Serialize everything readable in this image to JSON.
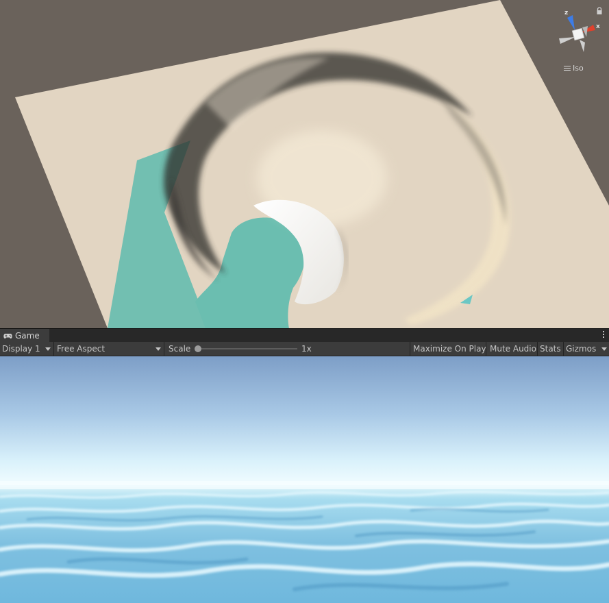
{
  "scene_view": {
    "gizmo": {
      "axis_z": "z",
      "axis_x": "x"
    },
    "projection_label": "Iso",
    "colors": {
      "background": "#6a625b",
      "terrain": "#e2d5c2",
      "water": "#6bbeb0",
      "snow": "#f7f6f1"
    }
  },
  "game_tab": {
    "label": "Game",
    "icon": "gamepad-icon"
  },
  "game_toolbar": {
    "display_select": "Display 1",
    "aspect_select": "Free Aspect",
    "scale_label": "Scale",
    "scale_value": "1x",
    "scale_fraction": 0,
    "maximize_on_play": "Maximize On Play",
    "mute_audio": "Mute Audio",
    "stats": "Stats",
    "gizmos": "Gizmos"
  },
  "game_view": {
    "colors": {
      "sky_top": "#7d9ec7",
      "sky_horizon": "#eafaff",
      "ocean": "#7fc0e0"
    }
  }
}
